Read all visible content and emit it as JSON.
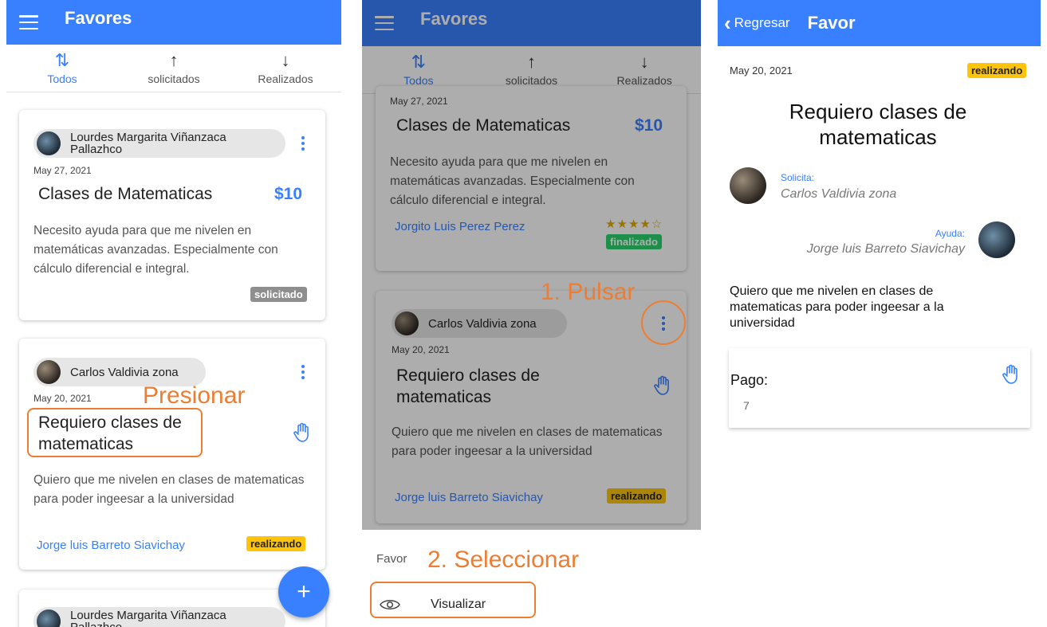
{
  "list_screen": {
    "app_title": "Favores",
    "tabs": [
      {
        "label": "Todos",
        "icon": "⇅"
      },
      {
        "label": "solicitados",
        "icon": "↑"
      },
      {
        "label": "Realizados",
        "icon": "↓"
      }
    ],
    "cards": [
      {
        "user": "Lourdes Margarita Viñanzaca Pallazhco",
        "date": "May 27, 2021",
        "title": "Clases de Matematicas",
        "price": "$10",
        "description": "Necesito ayuda para que me nivelen en matemáticas avanzadas. Especialmente con cálculo diferencial e integral.",
        "status": "solicitado"
      },
      {
        "user": "Carlos Valdivia zona",
        "date": "May 20, 2021",
        "title": "Requiero clases de matematicas",
        "description": "Quiero que me nivelen en clases de matematicas para poder ingeesar a la universidad",
        "helper": "Jorge luis Barreto Siavichay",
        "status": "realizando"
      },
      {
        "user": "Lourdes Margarita Viñanzaca Pallazhco"
      }
    ],
    "annotation": "Presionar",
    "fab_label": "+"
  },
  "menu_screen": {
    "app_title": "Favores",
    "tabs": [
      {
        "label": "Todos",
        "icon": "⇅"
      },
      {
        "label": "solicitados",
        "icon": "↑"
      },
      {
        "label": "Realizados",
        "icon": "↓"
      }
    ],
    "cards": [
      {
        "date": "May 27, 2021",
        "title": "Clases de Matematicas",
        "price": "$10",
        "description": "Necesito ayuda para que me nivelen en matemáticas avanzadas. Especialmente con cálculo diferencial e integral.",
        "helper": "Jorgito Luis Perez Perez",
        "rating": "★★★★☆",
        "status": "finalizado"
      },
      {
        "user": "Carlos Valdivia zona",
        "date": "May 20, 2021",
        "title": "Requiero clases de matematicas",
        "description": "Quiero que me nivelen en clases de matematicas para poder ingeesar a la universidad",
        "helper": "Jorge luis Barreto Siavichay",
        "status": "realizando"
      }
    ],
    "annotation_1": "1. Pulsar",
    "annotation_2": "2. Seleccionar",
    "sheet": {
      "title": "Favor",
      "items": [
        {
          "label": "Visualizar",
          "icon": "eye-icon"
        }
      ]
    }
  },
  "detail_screen": {
    "back_label": "Regresar",
    "title": "Favor",
    "date": "May 20, 2021",
    "status": "realizando",
    "heading": "Requiero clases de matematicas",
    "requester_label": "Solicita:",
    "requester_name": "Carlos Valdivia zona",
    "helper_label": "Ayuda:",
    "helper_name": "Jorge luis Barreto Siavichay",
    "description": "Quiero que me nivelen en clases de matematicas para poder ingeesar a la universidad",
    "payment_label": "Pago:",
    "payment_value": "7"
  },
  "colors": {
    "primary": "#3880ff",
    "annotation": "#ed7d31",
    "badge_warning": "#ffc409",
    "badge_success": "#2dd36f",
    "badge_medium": "#8e8e8e"
  }
}
